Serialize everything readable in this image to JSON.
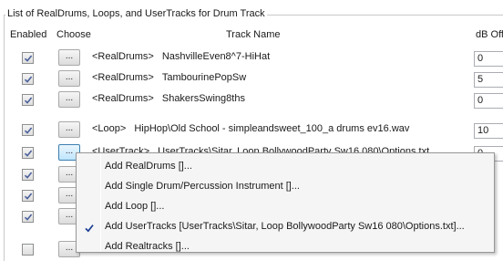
{
  "group_title": "List of RealDrums, Loops, and UserTracks for Drum Track",
  "columns": {
    "enabled": "Enabled",
    "choose": "Choose",
    "track_name": "Track Name",
    "db_offset": "dB Offs"
  },
  "choose_label": "...",
  "rows": [
    {
      "enabled": true,
      "tag": "<RealDrums>",
      "name": "NashvilleEven8^7-HiHat",
      "db": "0"
    },
    {
      "enabled": true,
      "tag": "<RealDrums>",
      "name": "TambourinePopSw",
      "db": "5"
    },
    {
      "enabled": true,
      "tag": "<RealDrums>",
      "name": "ShakersSwing8ths",
      "db": "0"
    },
    {
      "enabled": true,
      "tag": "<Loop>",
      "name": "HipHop\\Old School - simpleandsweet_100_a drums ev16.wav",
      "db": "10"
    },
    {
      "enabled": true,
      "tag": "<UserTrack>",
      "name": "UserTracks\\Sitar, Loop BollywoodParty Sw16 080\\Options.txt",
      "db": "0"
    },
    {
      "enabled": true
    },
    {
      "enabled": true
    },
    {
      "enabled": true
    },
    {
      "enabled": false
    }
  ],
  "context_menu": {
    "items": [
      {
        "label": "Add RealDrums []...",
        "checked": false
      },
      {
        "label": "Add Single Drum/Percussion Instrument []...",
        "checked": false
      },
      {
        "label": "Add Loop []...",
        "checked": false
      },
      {
        "label": "Add UserTracks [UserTracks\\Sitar, Loop BollywoodParty Sw16 080\\Options.txt]...",
        "checked": true
      },
      {
        "label": "Add Realtracks []...",
        "checked": false
      }
    ]
  },
  "colors": {
    "checkmark": "#4a5f9a",
    "active_button": "#3c7fb1",
    "menu_bg": "#f5f5f5"
  },
  "icons": {
    "checkbox_mark": "check-icon",
    "menu_check": "checkmark-icon"
  }
}
